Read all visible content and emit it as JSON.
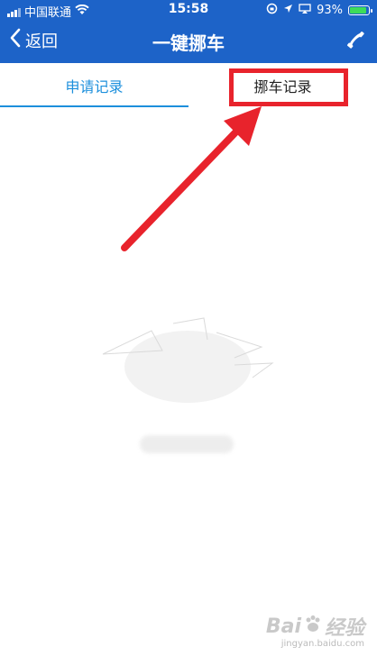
{
  "status_bar": {
    "carrier": "中国联通",
    "time": "15:58",
    "battery": "93%",
    "battery_level": 0.93
  },
  "nav": {
    "back_label": "返回",
    "title": "一键挪车"
  },
  "tabs": [
    {
      "label": "申请记录",
      "active": true
    },
    {
      "label": "挪车记录",
      "active": false
    }
  ],
  "colors": {
    "nav_bg": "#1d63c8",
    "tab_active": "#1c8fdc",
    "annotation": "#e8232c"
  },
  "icons": {
    "back": "chevron-left-icon",
    "phone": "phone-icon",
    "wifi": "wifi-icon",
    "location": "location-arrow-icon",
    "airplay": "airplay-icon"
  },
  "watermark": {
    "brand_left": "Bai",
    "brand_right": "经验",
    "sub": "jingyan.baidu.com"
  }
}
